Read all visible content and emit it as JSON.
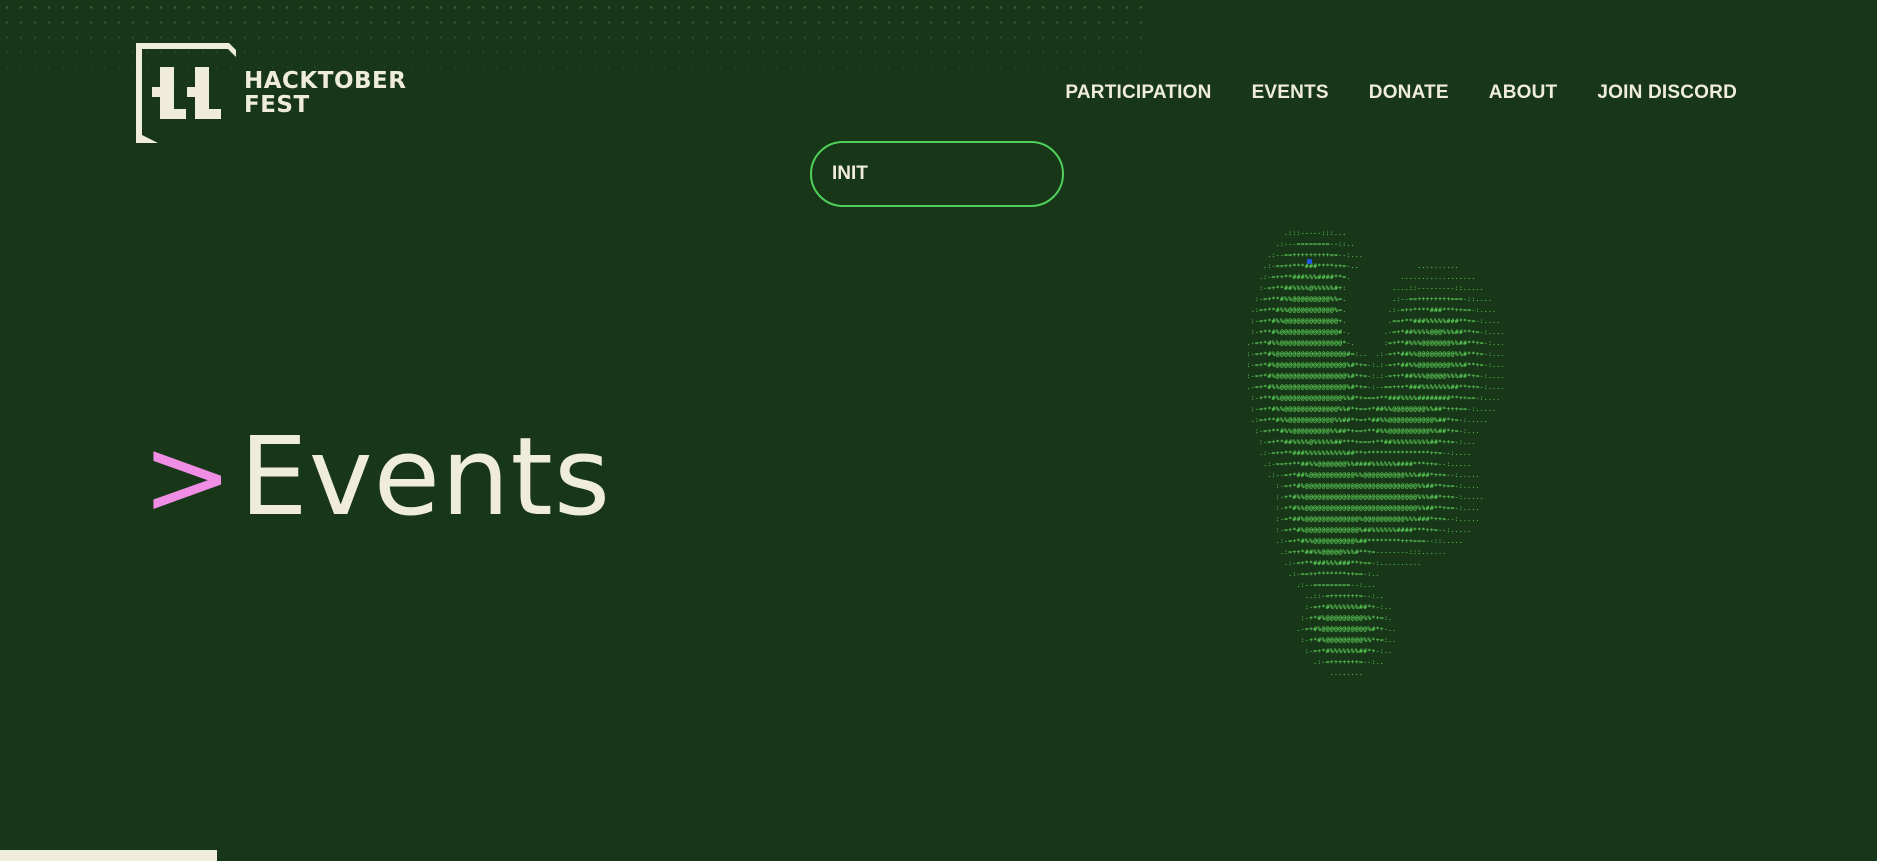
{
  "brand": {
    "name_line1": "HACKTOBER",
    "name_line2": "FEST",
    "logo_icon": "hacktoberfest-11-logo-icon"
  },
  "nav": {
    "items": [
      {
        "label": "PARTICIPATION"
      },
      {
        "label": "EVENTS"
      },
      {
        "label": "DONATE"
      },
      {
        "label": "ABOUT"
      },
      {
        "label": "JOIN DISCORD"
      }
    ]
  },
  "init_button": {
    "label": "INIT"
  },
  "hero": {
    "prompt": ">",
    "title": "Events"
  },
  "colors": {
    "background": "#183618",
    "text": "#efedd9",
    "accent_green": "#50d05a",
    "accent_pink": "#f08ee6",
    "ascii_green": "#5ed35a",
    "cursor_blue": "#2454e0"
  }
}
